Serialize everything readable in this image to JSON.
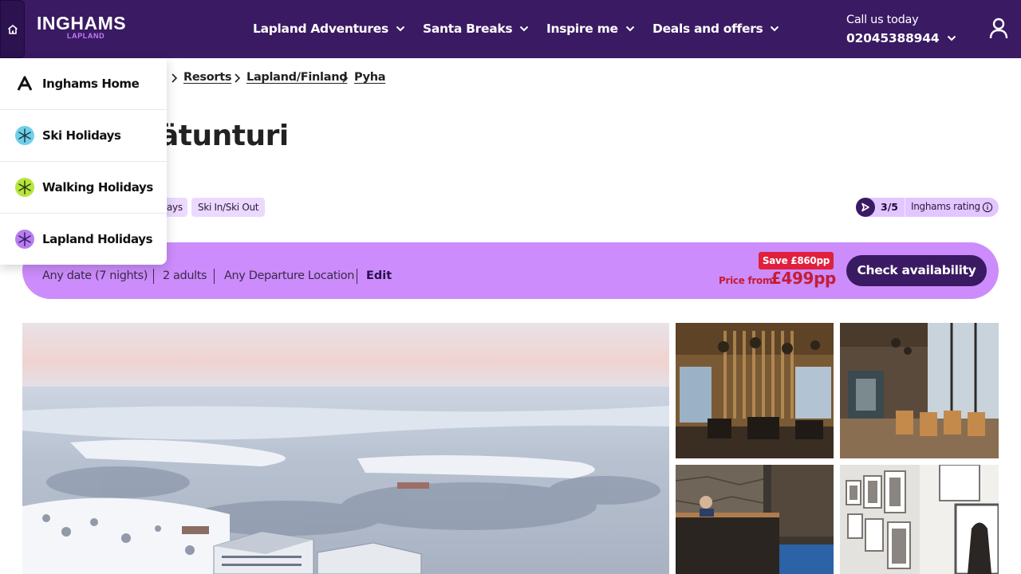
{
  "header": {
    "logo_main": "INGHAMS",
    "logo_sub": "LAPLAND",
    "nav": [
      {
        "label": "Lapland Adventures"
      },
      {
        "label": "Santa Breaks"
      },
      {
        "label": "Inspire me"
      },
      {
        "label": "Deals and offers"
      }
    ],
    "call_label": "Call us today",
    "call_number": "02045388944",
    "colors": {
      "background": "#3a1a63",
      "accent": "#c77dff"
    }
  },
  "breadcrumb": {
    "items": [
      {
        "label": "Resorts"
      },
      {
        "label": "Lapland/Finland"
      },
      {
        "label": "Pyha"
      }
    ]
  },
  "hotel": {
    "title_visible": "ätunturi",
    "tags": [
      "ays",
      "Ski In/Ski Out"
    ],
    "rating_value": "3/5",
    "rating_label": "Inghams rating"
  },
  "search_summary": {
    "dates": "Any date (7 nights)",
    "guests": "2 adults",
    "departure": "Any Departure Location",
    "edit_label": "Edit",
    "save_badge": "Save £860pp",
    "price_label": "Price from",
    "price_value": "£499pp",
    "cta_label": "Check availability",
    "colors": {
      "bar": "#cc8cfb",
      "price": "#c41d36",
      "cta": "#3a1a63"
    }
  },
  "dropdown": {
    "items": [
      {
        "label": "Inghams Home",
        "icon": "inghams-logo-icon"
      },
      {
        "label": "Ski Holidays",
        "icon": "snowflake-icon",
        "color": "#6fd0e6"
      },
      {
        "label": "Walking Holidays",
        "icon": "snowflake-icon",
        "color": "#b6e63c"
      },
      {
        "label": "Lapland Holidays",
        "icon": "snowflake-icon",
        "color": "#b77ef0"
      }
    ]
  }
}
